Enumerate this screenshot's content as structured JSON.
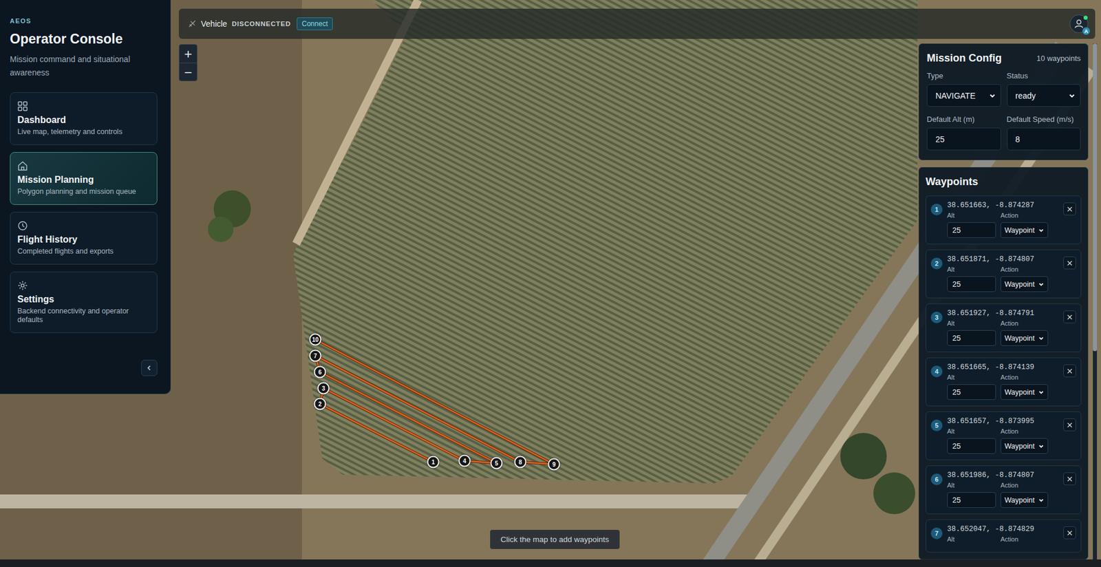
{
  "app": {
    "brand": "AEOS",
    "title": "Operator Console",
    "subtitle": "Mission command and situational awareness"
  },
  "nav": [
    {
      "label": "Dashboard",
      "desc": "Live map, telemetry and controls",
      "selected": false
    },
    {
      "label": "Mission Planning",
      "desc": "Polygon planning and mission queue",
      "selected": true
    },
    {
      "label": "Flight History",
      "desc": "Completed flights and exports",
      "selected": false
    },
    {
      "label": "Settings",
      "desc": "Backend connectivity and operator defaults",
      "selected": false
    }
  ],
  "topbar": {
    "vehicle_label": "Vehicle",
    "status": "DISCONNECTED",
    "connected": false,
    "connect_button": "Connect",
    "avatar_badge": "A",
    "online": true
  },
  "zoom": [
    "+",
    "−"
  ],
  "mission_config": {
    "title": "Mission Config",
    "count": "10 waypoints",
    "fields": [
      {
        "label": "Type",
        "value": "NAVIGATE",
        "kind": "select"
      },
      {
        "label": "Status",
        "value": "ready",
        "kind": "select"
      },
      {
        "label": "Default Alt (m)",
        "value": "25",
        "kind": "input"
      },
      {
        "label": "Default Speed (m/s)",
        "value": "8",
        "kind": "input"
      }
    ]
  },
  "waypoints": {
    "title": "Waypoints",
    "alt_label": "Alt",
    "action_label": "Action",
    "remove": "×",
    "items": [
      {
        "number": "1",
        "coords": "38.651663, -8.874287",
        "alt": "25",
        "action": "Waypoint"
      },
      {
        "number": "2",
        "coords": "38.651871, -8.874807",
        "alt": "25",
        "action": "Waypoint"
      },
      {
        "number": "3",
        "coords": "38.651927, -8.874791",
        "alt": "25",
        "action": "Waypoint"
      },
      {
        "number": "4",
        "coords": "38.651665, -8.874139",
        "alt": "25",
        "action": "Waypoint"
      },
      {
        "number": "5",
        "coords": "38.651657, -8.873995",
        "alt": "25",
        "action": "Waypoint"
      },
      {
        "number": "6",
        "coords": "38.651986, -8.874807",
        "alt": "25",
        "action": "Waypoint"
      },
      {
        "number": "7",
        "coords": "38.652047, -8.874829"
      }
    ]
  },
  "map": {
    "markers": [
      {
        "label": "1"
      },
      {
        "label": "2"
      },
      {
        "label": "3"
      },
      {
        "label": "4"
      },
      {
        "label": "5"
      },
      {
        "label": "6"
      },
      {
        "label": "7"
      },
      {
        "label": "8"
      },
      {
        "label": "9"
      },
      {
        "label": "10"
      }
    ]
  },
  "hint": "Click the map to add waypoints"
}
